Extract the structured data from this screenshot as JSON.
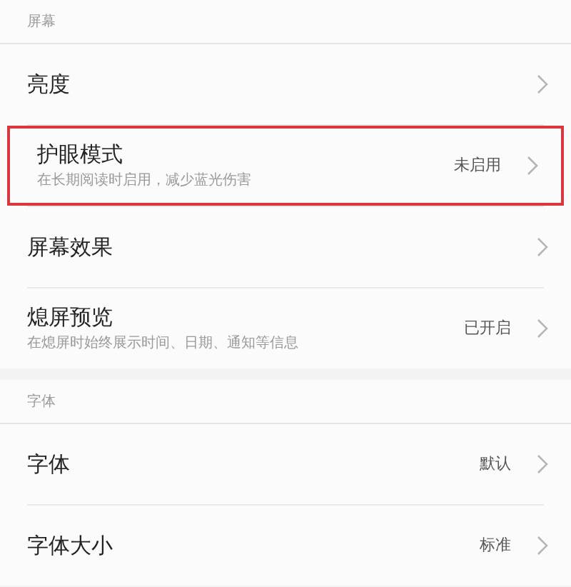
{
  "sections": [
    {
      "header": "屏幕",
      "items": [
        {
          "title": "亮度",
          "highlighted": false
        },
        {
          "title": "护眼模式",
          "subtitle": "在长期阅读时启用，减少蓝光伤害",
          "value": "未启用",
          "highlighted": true
        },
        {
          "title": "屏幕效果",
          "highlighted": false
        },
        {
          "title": "熄屏预览",
          "subtitle": "在熄屏时始终展示时间、日期、通知等信息",
          "value": "已开启",
          "highlighted": false
        }
      ]
    },
    {
      "header": "字体",
      "items": [
        {
          "title": "字体",
          "value": "默认",
          "highlighted": false
        },
        {
          "title": "字体大小",
          "value": "标准",
          "highlighted": false
        }
      ]
    }
  ]
}
